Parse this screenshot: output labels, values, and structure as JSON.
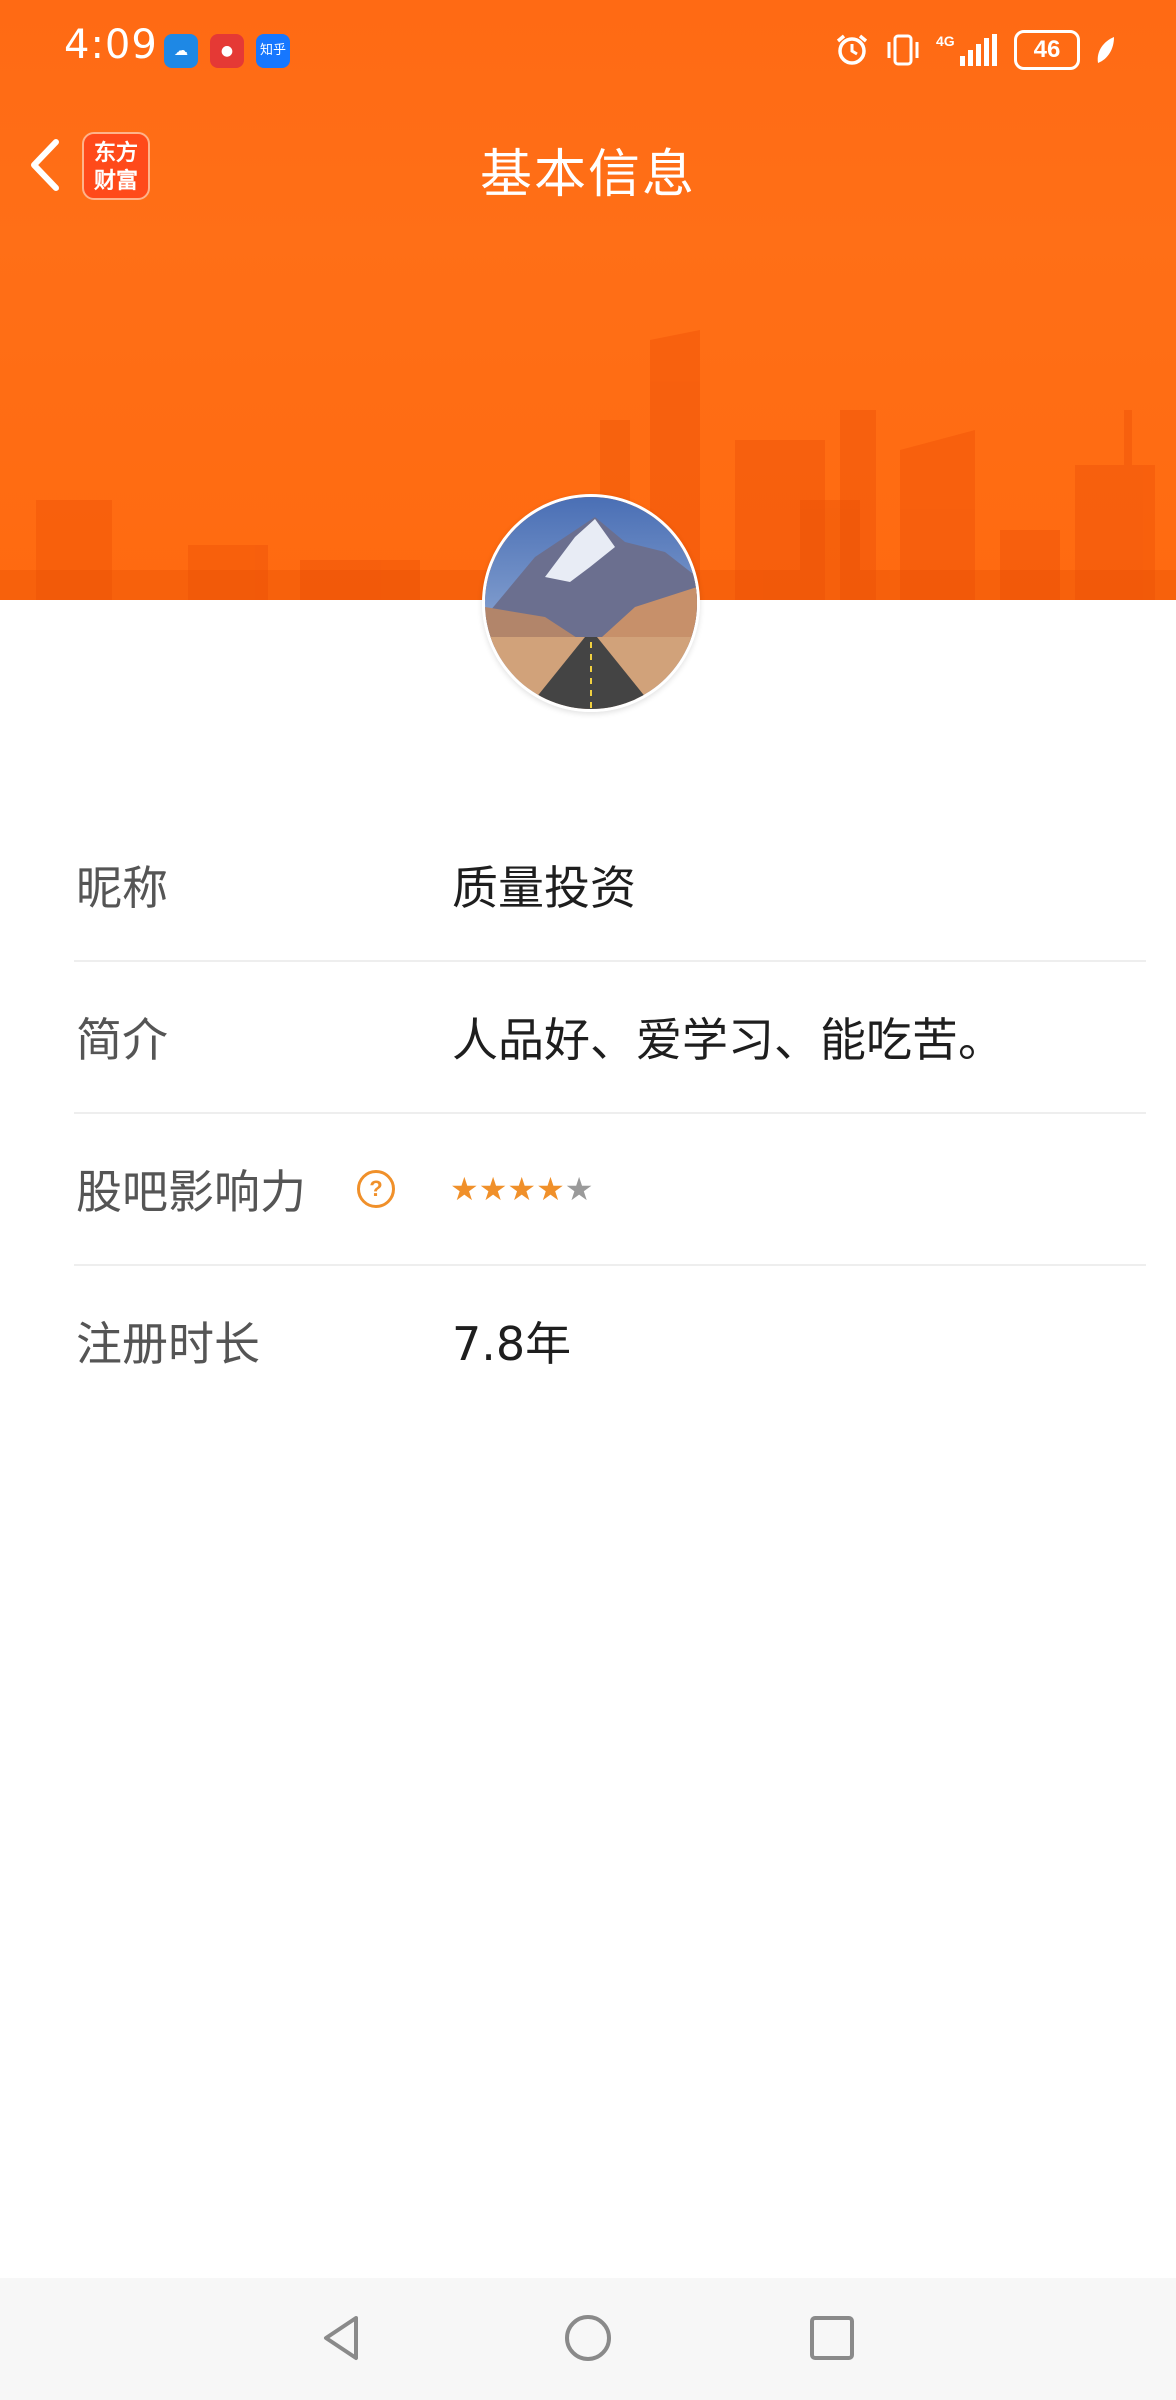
{
  "status_bar": {
    "time": "4:09",
    "notifications": [
      {
        "icon": "weather-app-icon",
        "color": "#1e88e5",
        "label": ""
      },
      {
        "icon": "news-app-icon",
        "color": "#e53935",
        "label": ""
      },
      {
        "icon": "zhihu-app-icon",
        "color": "#1677ff",
        "label": "知乎"
      }
    ],
    "network": "4G",
    "battery": "46"
  },
  "header": {
    "title": "基本信息",
    "back_icon": "chevron-left-icon",
    "app_badge": {
      "line1": "东方",
      "line2": "财富"
    },
    "accent_color": "#ff6a14"
  },
  "profile": {
    "avatar_description": "mountain-road-avatar"
  },
  "info": [
    {
      "label": "昵称",
      "value": "质量投资"
    },
    {
      "label": "简介",
      "value": "人品好、爱学习、能吃苦。"
    },
    {
      "label": "股吧影响力",
      "help_icon": "?",
      "rating": 4,
      "rating_max": 5
    },
    {
      "label": "注册时长",
      "value": "7.8年"
    }
  ],
  "system_nav": {
    "back": "triangle-back-icon",
    "home": "circle-home-icon",
    "recents": "square-recents-icon"
  }
}
